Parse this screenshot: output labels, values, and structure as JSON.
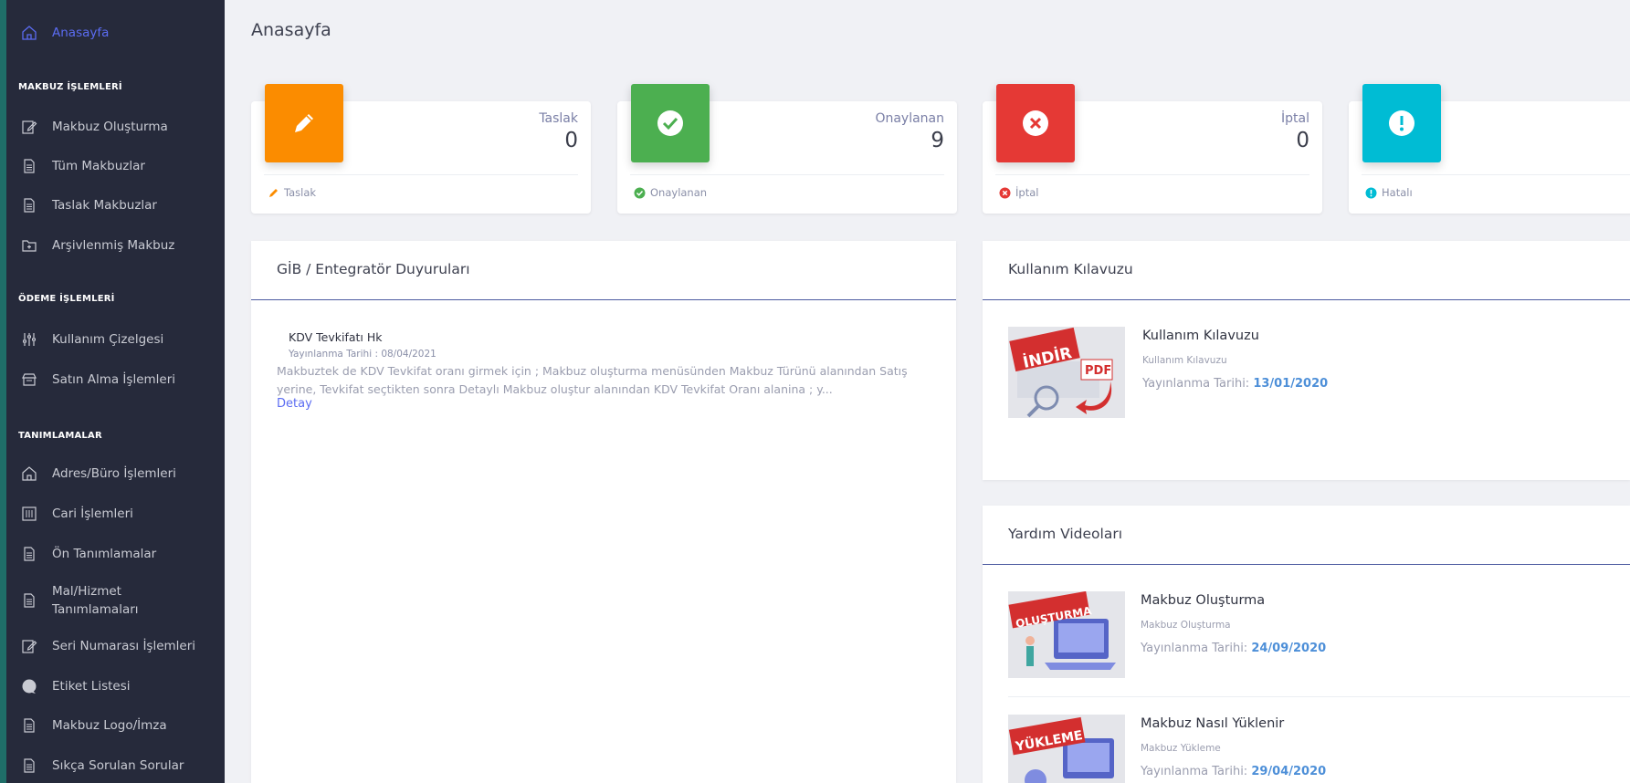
{
  "sidebar": {
    "home": "Anasayfa",
    "section1": "MAKBUZ İŞLEMLERİ",
    "s1_items": [
      "Makbuz Oluşturma",
      "Tüm Makbuzlar",
      "Taslak Makbuzlar",
      "Arşivlenmiş Makbuz"
    ],
    "section2": "ÖDEME İŞLEMLERİ",
    "s2_items": [
      "Kullanım Çizelgesi",
      "Satın Alma İşlemleri"
    ],
    "section3": "TANIMLAMALAR",
    "s3_items": [
      "Adres/Büro İşlemleri",
      "Cari İşlemleri",
      "Ön Tanımlamalar",
      "Mal/Hizmet",
      "Tanımlamaları",
      "Seri Numarası İşlemleri",
      "Etiket Listesi",
      "Makbuz Logo/İmza",
      "Sıkça Sorulan Sorular"
    ]
  },
  "page_title": "Anasayfa",
  "stats": [
    {
      "label": "Taslak",
      "value": "0",
      "foot": "Taslak",
      "color": "#fb8c00"
    },
    {
      "label": "Onaylanan",
      "value": "9",
      "foot": "Onaylanan",
      "color": "#4caf50"
    },
    {
      "label": "İptal",
      "value": "0",
      "foot": "İptal",
      "color": "#e53935"
    },
    {
      "label": "",
      "value": "",
      "foot": "Hatalı",
      "color": "#00bcd4"
    }
  ],
  "announcements": {
    "title": "GİB / Entegratör Duyuruları",
    "item_title": "KDV Tevkifatı Hk",
    "item_date": "Yayınlanma Tarihi : 08/04/2021",
    "item_body": "Makbuztek de KDV Tevkifat oranı girmek için ; Makbuz oluşturma menüsünden Makbuz Türünü alanından Satış yerine, Tevkifat seçtikten sonra Detaylı Makbuz oluştur alanından KDV Tevkifat Oranı alanina ; y...",
    "link": "Detay"
  },
  "guide": {
    "title": "Kullanım Kılavuzu",
    "thumb_text": "İNDİR",
    "thumb_badge": "PDF",
    "item_title": "Kullanım Kılavuzu",
    "item_sub": "Kullanım Kılavuzu",
    "date_label": "Yayınlanma Tarihi:",
    "date": "13/01/2020"
  },
  "videos": {
    "title": "Yardım Videoları",
    "items": [
      {
        "thumb_text": "OLUŞTURMA",
        "title": "Makbuz Oluşturma",
        "sub": "Makbuz Oluşturma",
        "date_label": "Yayınlanma Tarihi:",
        "date": "24/09/2020"
      },
      {
        "thumb_text": "YÜKLEME",
        "title": "Makbuz Nasıl Yüklenir",
        "sub": "Makbuz Yükleme",
        "date_label": "Yayınlanma Tarihi:",
        "date": "29/04/2020"
      }
    ]
  }
}
